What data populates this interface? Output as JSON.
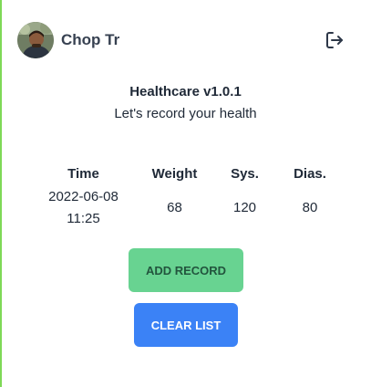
{
  "user": {
    "name": "Chop Tr"
  },
  "app": {
    "title": "Healthcare v1.0.1",
    "subtitle": "Let's record your health"
  },
  "table": {
    "headers": [
      "Time",
      "Weight",
      "Sys.",
      "Dias."
    ],
    "rows": [
      {
        "time_date": "2022-06-08",
        "time_clock": "11:25",
        "weight": "68",
        "sys": "120",
        "dias": "80"
      }
    ]
  },
  "buttons": {
    "add_label": "ADD RECORD",
    "clear_label": "CLEAR LIST"
  },
  "icons": {
    "logout": "logout-icon",
    "avatar": "user-avatar"
  },
  "colors": {
    "left_border": "#7ed957",
    "add_button_bg": "#68d391",
    "add_button_text": "#22543d",
    "clear_button_bg": "#3b82f6",
    "clear_button_text": "#ffffff"
  }
}
